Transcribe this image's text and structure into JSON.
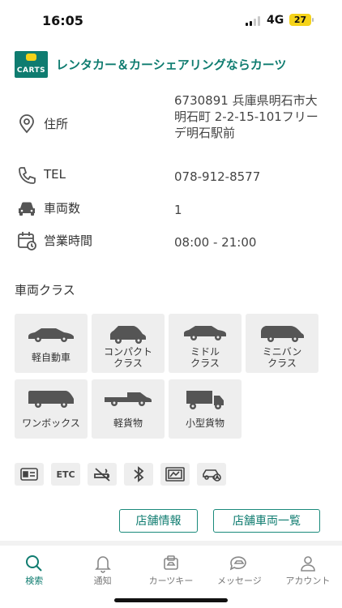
{
  "status_bar": {
    "time": "16:05",
    "network": "4G",
    "battery": "27"
  },
  "header": {
    "logo_text": "CARTS",
    "title": "レンタカー＆カーシェアリングならカーツ"
  },
  "info": {
    "address_label": "住所",
    "address_value": "6730891 兵庫県明石市大明石町 2-2-15-101フリーデ明石駅前",
    "tel_label": "TEL",
    "tel_value": "078-912-8577",
    "count_label": "車両数",
    "count_value": "1",
    "hours_label": "営業時間",
    "hours_value": "08:00 - 21:00"
  },
  "vehicle_classes": {
    "title": "車両クラス",
    "items": [
      {
        "line1": "軽自動車",
        "line2": ""
      },
      {
        "line1": "コンパクト",
        "line2": "クラス"
      },
      {
        "line1": "ミドル",
        "line2": "クラス"
      },
      {
        "line1": "ミニバン",
        "line2": "クラス"
      },
      {
        "line1": "ワンボックス",
        "line2": ""
      },
      {
        "line1": "軽貨物",
        "line2": ""
      },
      {
        "line1": "小型貨物",
        "line2": ""
      }
    ]
  },
  "equipment": {
    "etc": "ETC",
    "icons": [
      "card-reader-icon",
      "etc-icon",
      "no-smoking-icon",
      "bluetooth-icon",
      "navigation-icon",
      "car-gps-icon"
    ]
  },
  "buttons": {
    "store_info": "店舗情報",
    "store_vehicles": "店舗車両一覧"
  },
  "nav": {
    "search": "検索",
    "notify": "通知",
    "carkey": "カーツキー",
    "message": "メッセージ",
    "account": "アカウント"
  },
  "colors": {
    "brand": "#0f7c70",
    "accent_yellow": "#f5d31a",
    "tile_bg": "#eeeeee"
  }
}
